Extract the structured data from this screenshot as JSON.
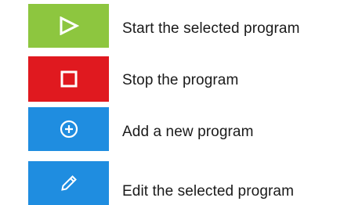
{
  "colors": {
    "start": "#8dc63f",
    "stop": "#e0191f",
    "add": "#1f8de0",
    "edit": "#1f8de0",
    "icon": "#ffffff"
  },
  "items": [
    {
      "icon": "play-icon",
      "label": "Start the selected program"
    },
    {
      "icon": "stop-icon",
      "label": "Stop the program"
    },
    {
      "icon": "add-circle-icon",
      "label": "Add a new program"
    },
    {
      "icon": "pencil-icon",
      "label": "Edit the selected program"
    }
  ]
}
